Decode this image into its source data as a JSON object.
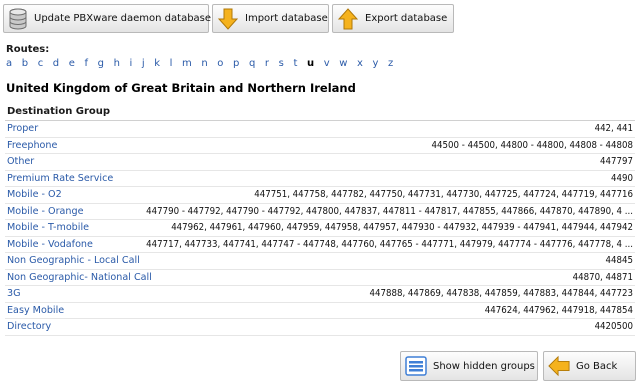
{
  "toolbar": {
    "update_label": "Update PBXware daemon database",
    "import_label": "Import database",
    "export_label": "Export database",
    "update_icon": "database-icon",
    "import_icon": "arrow-down-icon",
    "export_icon": "arrow-up-icon",
    "arrow_color": "#f5b21d"
  },
  "routes": {
    "label": "Routes:",
    "letters": [
      "a",
      "b",
      "c",
      "d",
      "e",
      "f",
      "g",
      "h",
      "i",
      "j",
      "k",
      "l",
      "m",
      "n",
      "o",
      "p",
      "q",
      "r",
      "s",
      "t",
      "u",
      "v",
      "w",
      "x",
      "y",
      "z"
    ],
    "active_letter": "u"
  },
  "country": "United Kingdom of Great Britain and Northern Ireland",
  "table": {
    "header": "Destination Group",
    "rows": [
      {
        "name": "Proper",
        "codes": "442, 441"
      },
      {
        "name": "Freephone",
        "codes": "44500 - 44500, 44800 - 44800, 44808 - 44808"
      },
      {
        "name": "Other",
        "codes": "447797"
      },
      {
        "name": "Premium Rate Service",
        "codes": "4490"
      },
      {
        "name": "Mobile - O2",
        "codes": "447751, 447758, 447782, 447750, 447731, 447730, 447725, 447724, 447719, 447716"
      },
      {
        "name": "Mobile - Orange",
        "codes": "447790 - 447792, 447790 - 447792, 447800, 447837, 447811 - 447817, 447855, 447866, 447870, 447890, 4 ..."
      },
      {
        "name": "Mobile - T-mobile",
        "codes": "447962, 447961, 447960, 447959, 447958, 447957, 447930 - 447932, 447939 - 447941, 447944, 447942"
      },
      {
        "name": "Mobile - Vodafone",
        "codes": "447717, 447733, 447741, 447747 - 447748, 447760, 447765 - 447771, 447979, 447774 - 447776, 447778, 4 ..."
      },
      {
        "name": "Non Geographic - Local Call",
        "codes": "44845"
      },
      {
        "name": "Non Geographic- National Call",
        "codes": "44870, 44871"
      },
      {
        "name": "3G",
        "codes": "447888, 447869, 447838, 447859, 447883, 447844, 447723"
      },
      {
        "name": "Easy Mobile",
        "codes": "447624, 447962, 447918, 447854"
      },
      {
        "name": "Directory",
        "codes": "4420500"
      }
    ]
  },
  "footer": {
    "show_hidden_label": "Show hidden groups",
    "go_back_label": "Go Back",
    "show_hidden_icon": "list-icon",
    "go_back_icon": "arrow-left-icon"
  },
  "colors": {
    "link": "#2a5aa8",
    "arrow": "#f5b21d",
    "list_blue": "#3f7fd6"
  }
}
